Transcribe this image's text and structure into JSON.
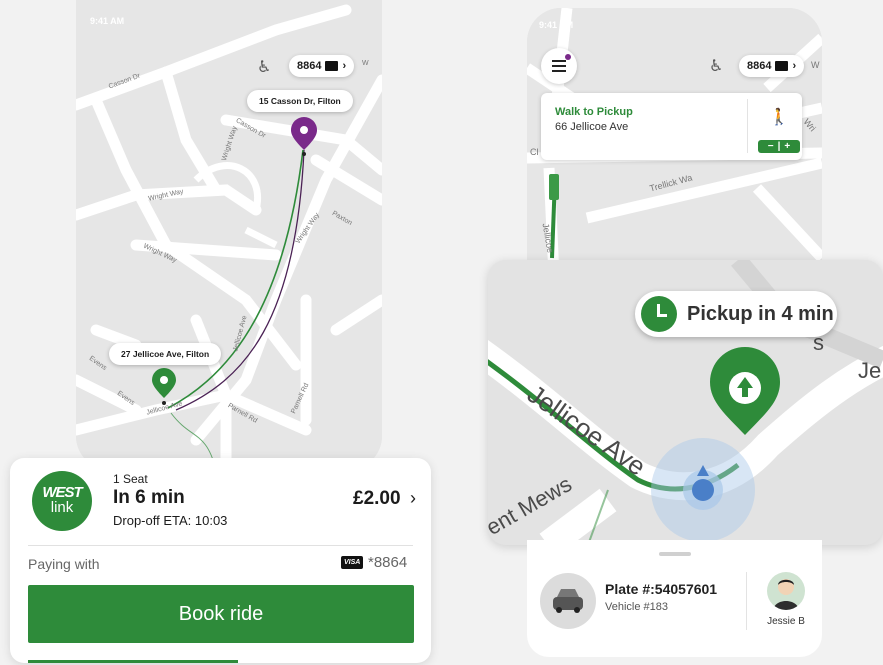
{
  "left_phone": {
    "status_time": "9:41 AM",
    "id_chip": {
      "number": "8864"
    },
    "streets": [
      "Casson Dr",
      "Wright Way",
      "Wright Way",
      "Wright Way",
      "Jellicoe Ave",
      "Jellicoe Ave",
      "Parnell Rd",
      "Parnell Rd",
      "Evens",
      "Evens",
      "Paxton",
      "Casson Dr",
      "Wright Way",
      "W"
    ],
    "destination_label": "15 Casson Dr, Filton",
    "origin_label": "27 Jellicoe Ave, Filton",
    "booking": {
      "logo_top": "WEST",
      "logo_bottom": "link",
      "seats": "1 Seat",
      "eta": "In 6 min",
      "dropoff": "Drop-off ETA: 10:03",
      "price": "£2.00",
      "paying_label": "Paying with",
      "card_brand": "VISA",
      "card_number": "*8864",
      "book_button": "Book ride"
    }
  },
  "right_phone": {
    "status_time": "9:41 AM",
    "id_chip": {
      "number": "8864"
    },
    "walk": {
      "title": "Walk to Pickup",
      "address": "66 Jellicoe Ave",
      "stepper_minus": "−",
      "stepper_plus": "+"
    },
    "streets": [
      "Trellick Wa",
      "Jellicoe",
      "Wri",
      "W",
      "Cl"
    ],
    "zoom": {
      "pickup_text": "Pickup in 4 min",
      "streets": [
        "Jellicoe Ave",
        "ent Mews",
        "s",
        "Je"
      ]
    },
    "vehicle": {
      "plate": "Plate #:54057601",
      "vehicle_no": "Vehicle #183",
      "driver": "Jessie B"
    }
  },
  "colors": {
    "green": "#2e8b3a",
    "purple": "#7a2a8a",
    "map_bg": "#e6e6e6",
    "road": "#ffffff"
  }
}
